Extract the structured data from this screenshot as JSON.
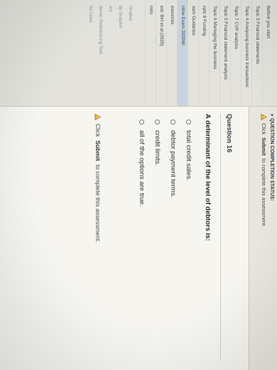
{
  "sidebar": {
    "items": [
      {
        "label": "Before you start"
      },
      {
        "label": "Topic 3 Financial statements"
      },
      {
        "label": "Topic 4 Analysing business transactions"
      },
      {
        "label": "Topic 7 CVP analysis"
      },
      {
        "label": "Topic 5 Financial statement analysis"
      },
      {
        "label": "Topic 6 Managing the business"
      },
      {
        "label": "opic 8 Funding"
      },
      {
        "label": "xam Guidance"
      },
      {
        "label": "nline Exam 202060"
      },
      {
        "label": "esources"
      },
      {
        "label": "ext: Birt et al (2020)"
      },
      {
        "label": "mlin"
      },
      {
        "label": "Grades"
      },
      {
        "label": "dy Support"
      },
      {
        "label": "ary"
      },
      {
        "label": "demic Referencing Tool"
      },
      {
        "label": "ful Links"
      }
    ]
  },
  "status": {
    "title": "QUESTION COMPLETION STATUS:",
    "click_word": "Click",
    "submit_word": "Submit",
    "message_rest": "to complete this assessment."
  },
  "question": {
    "number": "Question 16",
    "text": "A determinant of the level of debtors is:",
    "options": [
      {
        "label": "total credit sales."
      },
      {
        "label": "debtor payment terms."
      },
      {
        "label": "credit limits."
      },
      {
        "label": "all of the options are true."
      }
    ]
  },
  "footer": {
    "click_word": "Click",
    "submit_word": "Submit",
    "message_rest": "to complete this assessment."
  },
  "colors": {
    "warning": "#e0a020",
    "sidebar_bg": "#e3e2dc",
    "active_item": "#c9d3dd"
  },
  "icons": {
    "warning": "warning-triangle-icon",
    "caret": "caret-down-icon",
    "radio": "radio-button-icon"
  }
}
